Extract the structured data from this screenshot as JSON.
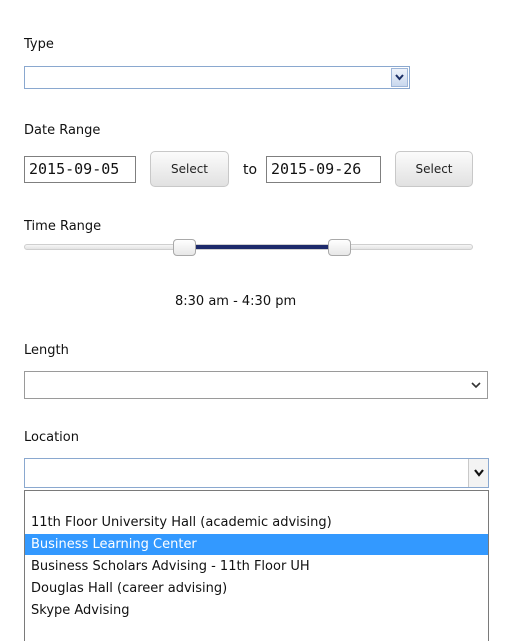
{
  "type_field": {
    "label": "Type",
    "value": ""
  },
  "date_range": {
    "label": "Date Range",
    "start": "2015-09-05",
    "end": "2015-09-26",
    "select_label": "Select",
    "to_label": "to"
  },
  "time_range": {
    "label": "Time Range",
    "text": "8:30 am - 4:30 pm"
  },
  "length_field": {
    "label": "Length",
    "value": ""
  },
  "location_field": {
    "label": "Location",
    "value": "",
    "options": [
      "",
      "11th Floor University Hall (academic advising)",
      "Business Learning Center",
      "Business Scholars Advising - 11th Floor UH",
      "Douglas Hall (career advising)",
      "Skype Advising"
    ],
    "highlighted_index": 2
  },
  "colors": {
    "highlight": "#3399ff",
    "range_fill": "#1d2a6b",
    "select_border": "#8aa8cf"
  },
  "icons": {
    "select_arrow": "chevron-down-icon"
  }
}
